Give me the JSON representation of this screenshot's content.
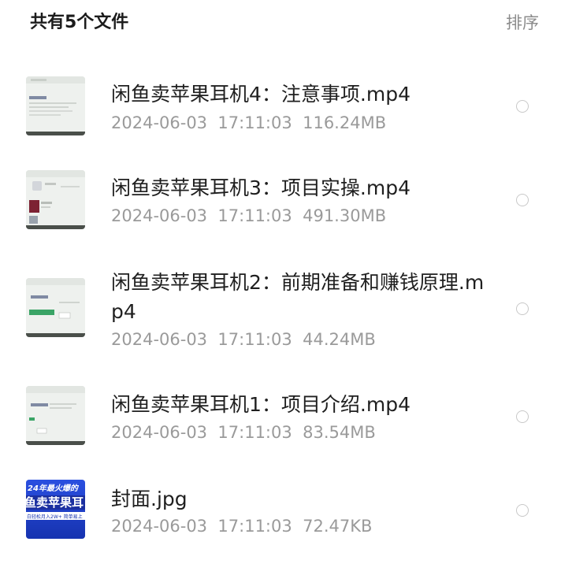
{
  "header": {
    "title": "共有5个文件",
    "sort_label": "排序"
  },
  "files": [
    {
      "name": "闲鱼卖苹果耳机4：注意事项.mp4",
      "date": "2024-06-03",
      "time": "17:11:03",
      "size": "116.24MB",
      "thumbnail": "video-thumbnail"
    },
    {
      "name": "闲鱼卖苹果耳机3：项目实操.mp4",
      "date": "2024-06-03",
      "time": "17:11:03",
      "size": "491.30MB",
      "thumbnail": "video-thumbnail"
    },
    {
      "name": "闲鱼卖苹果耳机2：前期准备和赚钱原理.mp4",
      "date": "2024-06-03",
      "time": "17:11:03",
      "size": "44.24MB",
      "thumbnail": "video-thumbnail"
    },
    {
      "name": "闲鱼卖苹果耳机1：项目介绍.mp4",
      "date": "2024-06-03",
      "time": "17:11:03",
      "size": "83.54MB",
      "thumbnail": "video-thumbnail"
    },
    {
      "name": "封面.jpg",
      "date": "2024-06-03",
      "time": "17:11:03",
      "size": "72.47KB",
      "thumbnail": "image-thumbnail",
      "thumbnail_text": [
        "24年最火爆的",
        "鱼卖苹果耳",
        "白轻松月入2W+ 简单易上"
      ]
    }
  ],
  "colors": {
    "text_primary": "#1f1f1f",
    "text_secondary": "#9a9a9a",
    "cover_blue": "#1d3fc8"
  }
}
